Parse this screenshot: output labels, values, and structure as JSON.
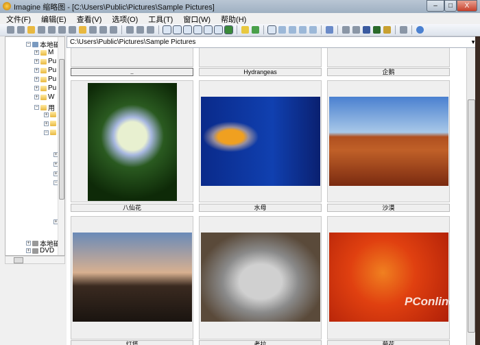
{
  "window": {
    "title": "Imagine 缩略图 - [C:\\Users\\Public\\Pictures\\Sample Pictures]",
    "min": "–",
    "max": "□",
    "close": "X"
  },
  "menu": [
    "文件(F)",
    "编辑(E)",
    "查看(V)",
    "选项(O)",
    "工具(T)",
    "窗口(W)",
    "帮助(H)"
  ],
  "address": "C:\\Users\\Public\\Pictures\\Sample Pictures",
  "tree": {
    "root": "本地磁",
    "children": [
      "M",
      "Pu",
      "Pu",
      "Pu",
      "Pu",
      "W",
      "用"
    ],
    "drive2": "本地磁",
    "dvd": "DVD"
  },
  "thumbnails": {
    "row0": [
      "..",
      "Hydrangeas",
      "企鹅"
    ],
    "row1": [
      "八仙花",
      "水母",
      "沙漠"
    ],
    "row2": [
      "灯塔",
      "考拉",
      "菊花"
    ]
  },
  "watermark": "PConline"
}
